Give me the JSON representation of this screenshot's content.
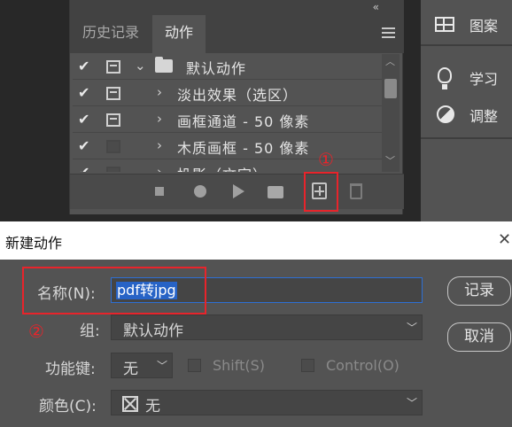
{
  "actions_panel": {
    "tabs": [
      {
        "label": "历史记录",
        "active": false
      },
      {
        "label": "动作",
        "active": true
      }
    ],
    "rows": [
      {
        "checked": true,
        "dialog_on": true,
        "expanded": true,
        "is_set": true,
        "label": "默认动作"
      },
      {
        "checked": true,
        "dialog_on": true,
        "expanded": false,
        "is_set": false,
        "label": "淡出效果（选区）"
      },
      {
        "checked": true,
        "dialog_on": true,
        "expanded": false,
        "is_set": false,
        "label": "画框通道 - 50 像素"
      },
      {
        "checked": true,
        "dialog_on": false,
        "expanded": false,
        "is_set": false,
        "label": "木质画框 - 50 像素"
      },
      {
        "checked": true,
        "dialog_on": false,
        "expanded": false,
        "is_set": false,
        "label": "投影（文字）"
      }
    ],
    "toolbar": [
      "stop-icon",
      "record-icon",
      "play-icon",
      "new-set-icon",
      "new-action-icon",
      "delete-icon"
    ]
  },
  "right_panel": {
    "items": [
      {
        "icon": "pattern-icon",
        "label": "图案"
      },
      {
        "icon": "learn-icon",
        "label": "学习"
      },
      {
        "icon": "adjustments-icon",
        "label": "调整"
      }
    ]
  },
  "annotations": {
    "marker1": "①",
    "marker2": "②",
    "color": "#e8242b"
  },
  "dialog": {
    "title": "新建动作",
    "close": "✕",
    "name_label": "名称(N):",
    "name_value": "pdf转jpg",
    "set_label": "组:",
    "set_value": "默认动作",
    "fkey_label": "功能键:",
    "fkey_value": "无",
    "shift_label": "Shift(S)",
    "control_label": "Control(O)",
    "color_label": "颜色(C):",
    "color_value": "无",
    "record_button": "记录",
    "cancel_button": "取消"
  }
}
